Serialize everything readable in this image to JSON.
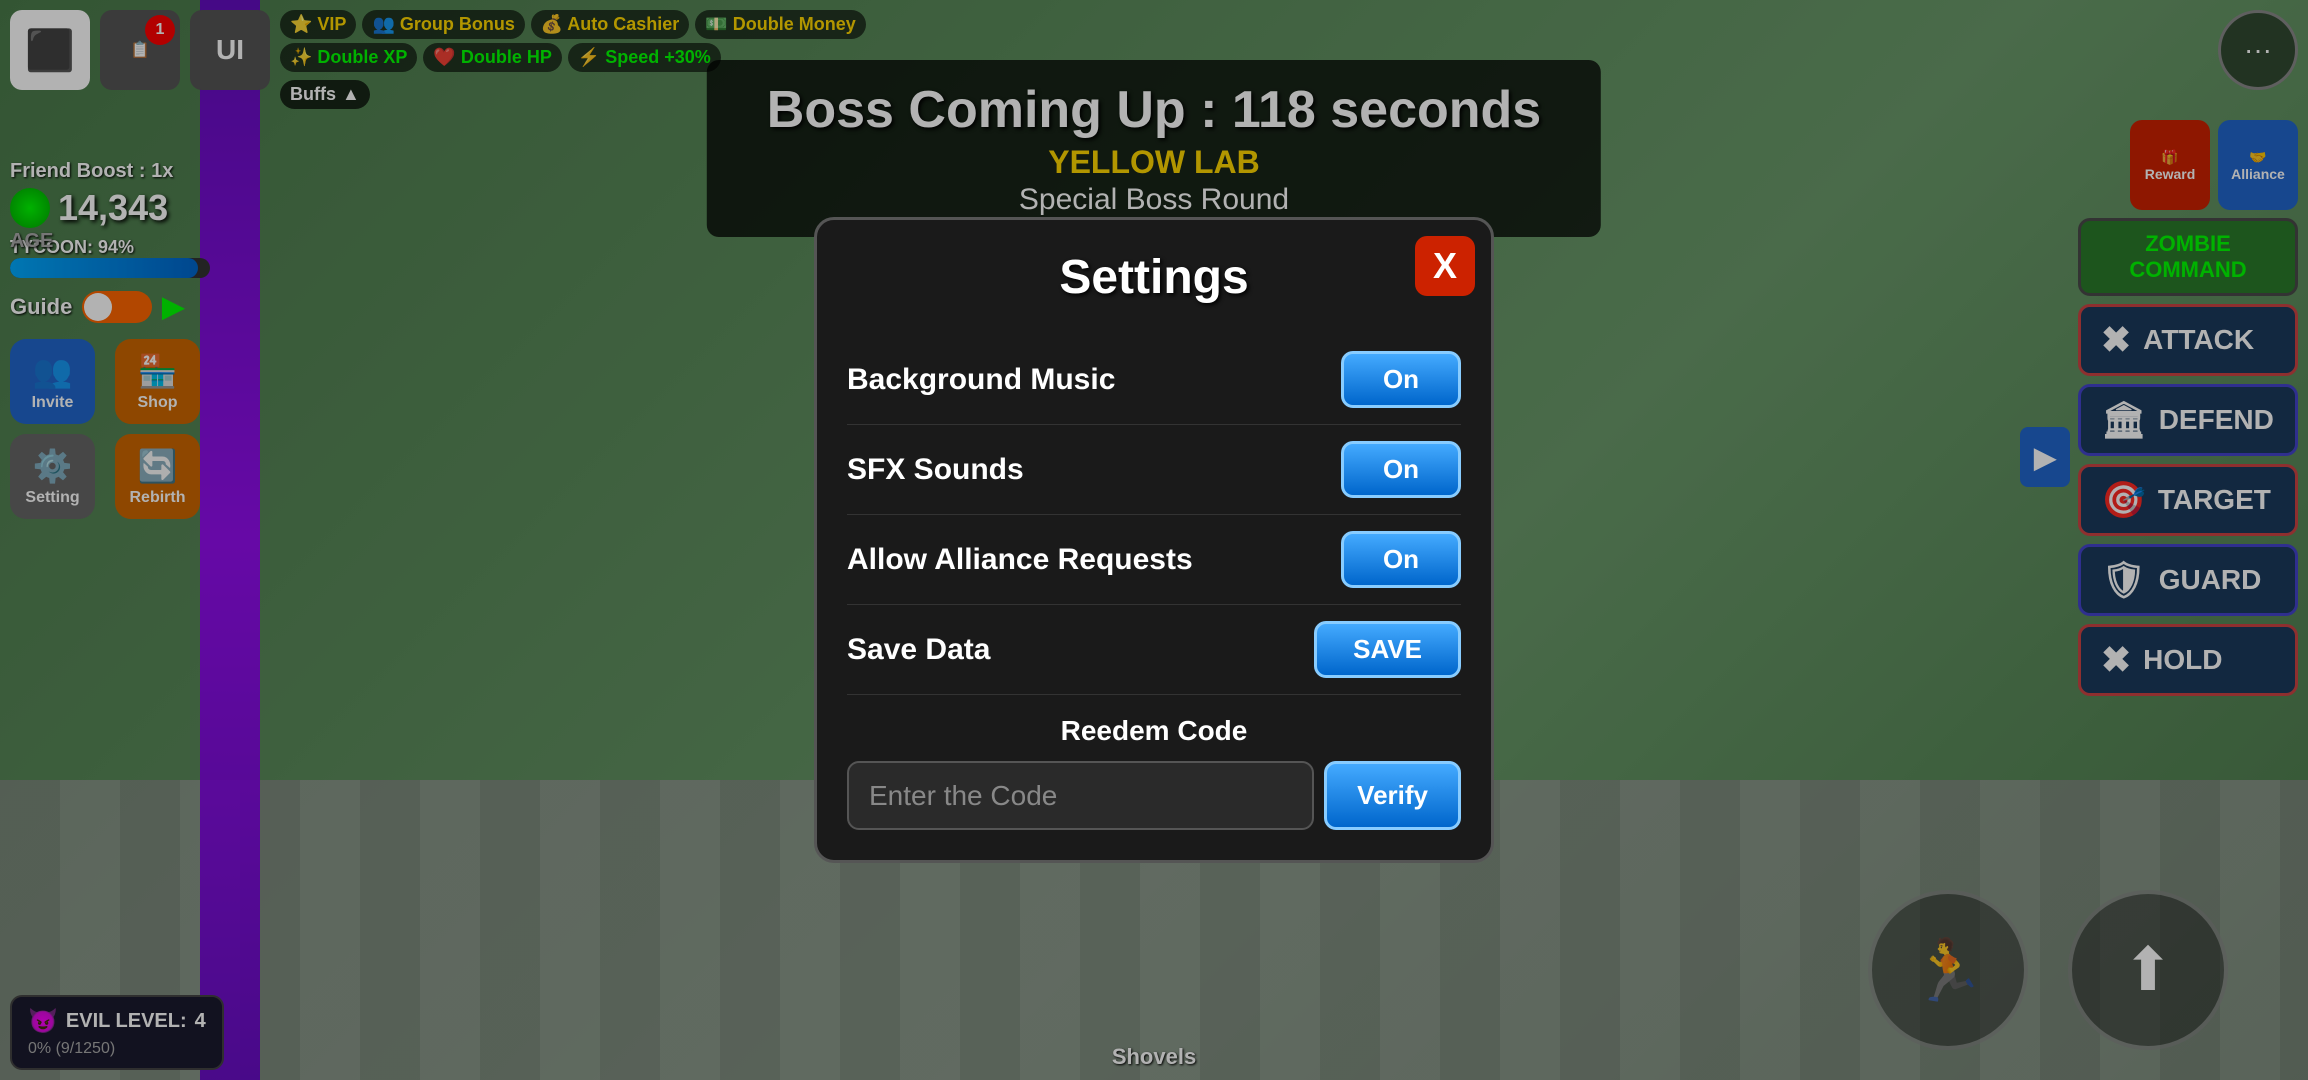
{
  "game": {
    "background_color": "#4a7a4a"
  },
  "top_hud": {
    "roblox_icon": "⬛",
    "notification_count": "1",
    "ui_label": "UI",
    "boosts": [
      {
        "label": "VIP",
        "icon": "⭐"
      },
      {
        "label": "Group Bonus",
        "icon": "👥"
      },
      {
        "label": "Auto Cashier",
        "icon": "💰"
      },
      {
        "label": "Double Money",
        "icon": "💵"
      },
      {
        "label": "Double XP",
        "icon": "✨"
      },
      {
        "label": "Double HP",
        "icon": "❤️"
      },
      {
        "label": "Speed +30%",
        "icon": "⚡"
      }
    ],
    "buffs_label": "Buffs"
  },
  "boss": {
    "announcement": "Boss Coming Up : 118 seconds",
    "lab_label": "YELLOW LAB",
    "special_round": "Special Boss Round"
  },
  "player": {
    "friend_boost": "Friend Boost : 1x",
    "currency": "14,343",
    "tycoon_label": "TYCOON: 94%",
    "tycoon_percent": 94,
    "guide_label": "Guide",
    "age_label": "AGE"
  },
  "left_actions": [
    {
      "label": "Invite",
      "icon": "👥"
    },
    {
      "label": "Shop",
      "icon": "🏪"
    },
    {
      "label": "Setting",
      "icon": "⚙️"
    },
    {
      "label": "Rebirth",
      "icon": "🔄"
    }
  ],
  "evil": {
    "label": "EVIL LEVEL:",
    "level": "4",
    "progress": "0% (9/1250)"
  },
  "right_panel": {
    "more_icon": "···",
    "reward_label": "Reward",
    "alliance_label": "Alliance",
    "zombie_cmd": "ZOMBIE\nCOMMAND",
    "combat_buttons": [
      {
        "label": "ATTACK",
        "icon": "✖"
      },
      {
        "label": "DEFEND",
        "icon": "🏛"
      },
      {
        "label": "TARGET",
        "icon": "🎯"
      },
      {
        "label": "GUARD",
        "icon": "🛡"
      },
      {
        "label": "HOLD",
        "icon": "✖"
      }
    ]
  },
  "shovels_label": "Shovels",
  "settings": {
    "title": "Settings",
    "close_label": "X",
    "rows": [
      {
        "label": "Background Music",
        "value": "On"
      },
      {
        "label": "SFX Sounds",
        "value": "On"
      },
      {
        "label": "Allow Alliance Requests",
        "value": "On"
      }
    ],
    "save_data_label": "Save Data",
    "save_button_label": "SAVE",
    "redeem": {
      "title": "Reedem Code",
      "placeholder": "Enter the Code",
      "verify_label": "Verify"
    }
  }
}
